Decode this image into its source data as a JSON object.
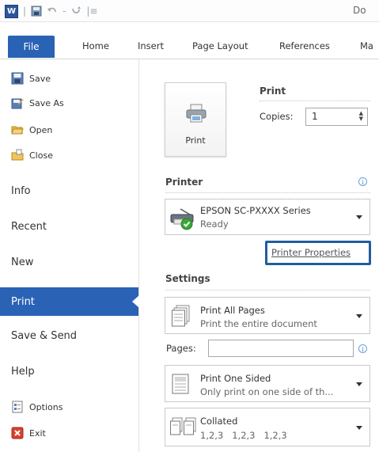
{
  "titlebar": {
    "app_icon_letter": "W",
    "doc_title": "Do"
  },
  "tabs": {
    "file": "File",
    "home": "Home",
    "insert": "Insert",
    "page_layout": "Page Layout",
    "references": "References",
    "mailings": "Ma"
  },
  "nav": {
    "save": "Save",
    "save_as": "Save As",
    "open": "Open",
    "close": "Close",
    "info": "Info",
    "recent": "Recent",
    "new": "New",
    "print": "Print",
    "save_send": "Save & Send",
    "help": "Help",
    "options": "Options",
    "exit": "Exit"
  },
  "print": {
    "heading": "Print",
    "button_label": "Print",
    "copies_label": "Copies:",
    "copies_value": "1"
  },
  "printer": {
    "heading": "Printer",
    "name": "EPSON SC-PXXXX Series",
    "status": "Ready",
    "properties_link": "Printer Properties"
  },
  "settings": {
    "heading": "Settings",
    "print_range_title": "Print All Pages",
    "print_range_sub": "Print the entire document",
    "pages_label": "Pages:",
    "sides_title": "Print One Sided",
    "sides_sub": "Only print on one side of th...",
    "collate_title": "Collated",
    "collate_sub": "1,2,3   1,2,3   1,2,3"
  },
  "colors": {
    "accent": "#2a62b5",
    "highlight_box": "#1f5e9e"
  }
}
